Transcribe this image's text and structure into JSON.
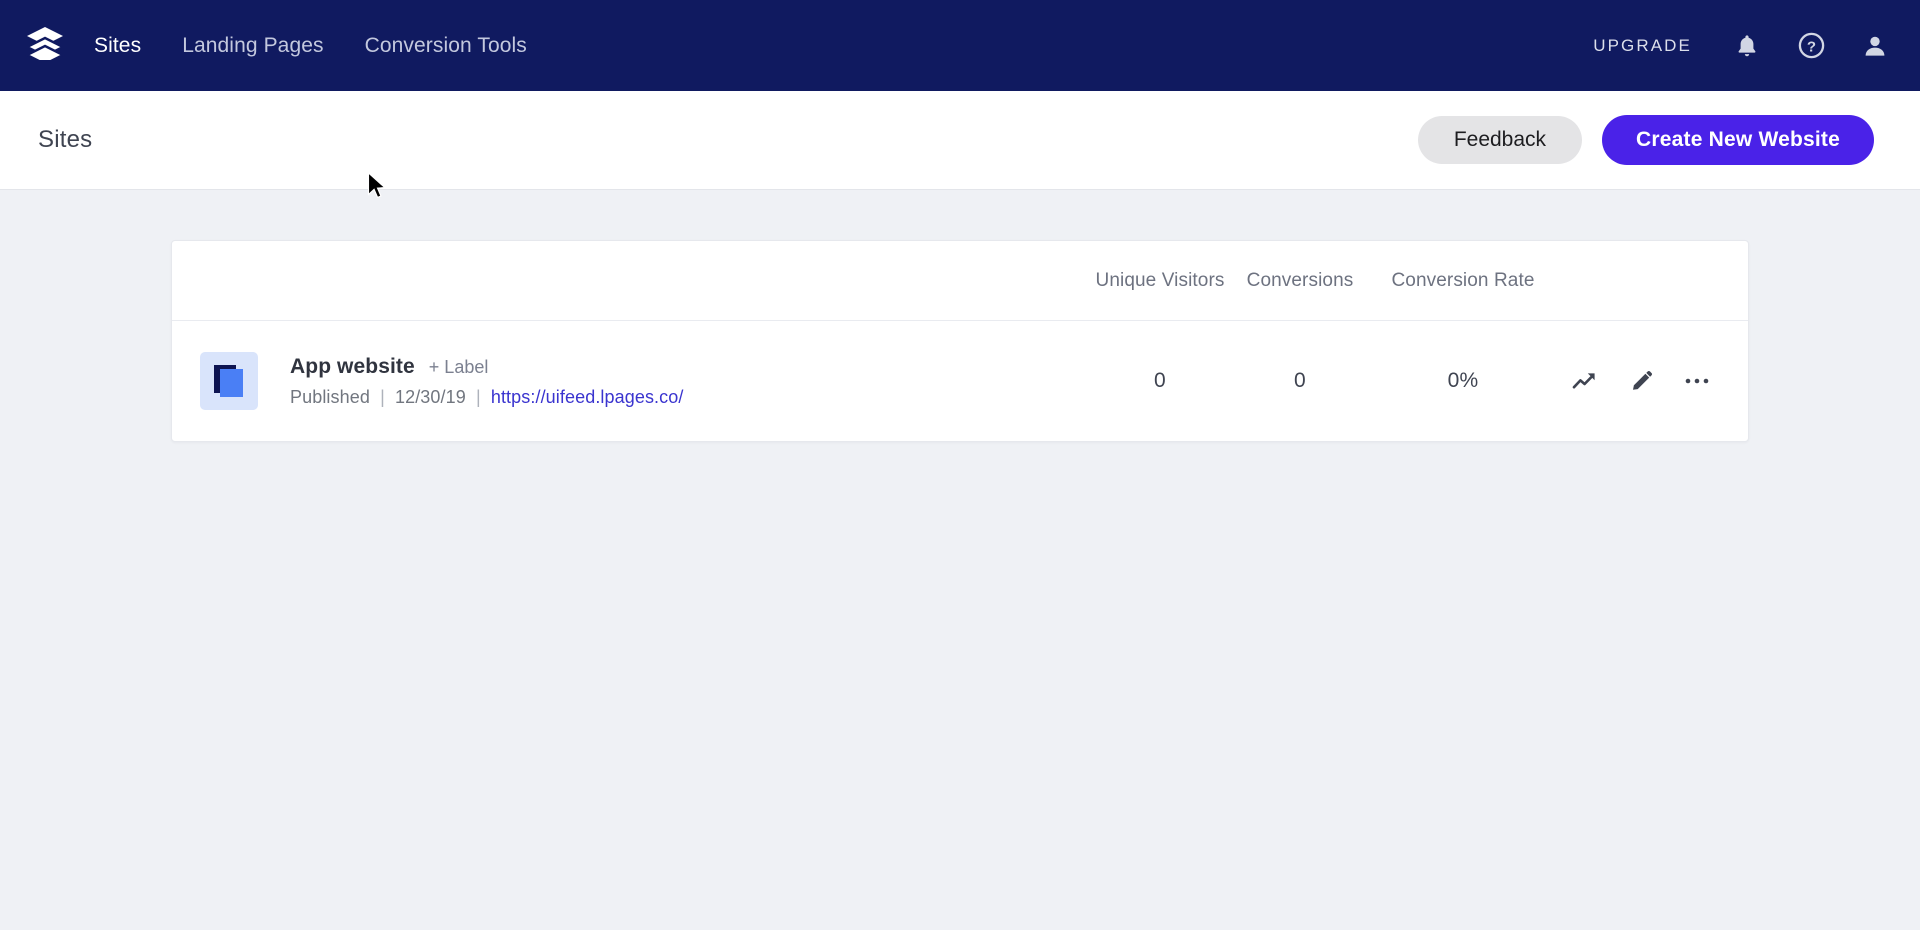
{
  "nav": {
    "logo_icon": "stacked-layers-logo",
    "links": [
      {
        "label": "Sites",
        "active": true
      },
      {
        "label": "Landing Pages",
        "active": false
      },
      {
        "label": "Conversion Tools",
        "active": false
      }
    ],
    "upgrade_label": "UPGRADE",
    "icons": [
      {
        "name": "notifications-bell-icon"
      },
      {
        "name": "help-question-circle-icon"
      },
      {
        "name": "account-person-icon"
      }
    ],
    "background_color": "#101a60"
  },
  "subheader": {
    "title": "Sites",
    "feedback_label": "Feedback",
    "create_label": "Create New Website",
    "create_color": "#4a22e8",
    "feedback_color": "#e4e4e6"
  },
  "table": {
    "columns": [
      {
        "label": "Unique Visitors"
      },
      {
        "label": "Conversions"
      },
      {
        "label": "Conversion Rate"
      }
    ],
    "rows": [
      {
        "thumbnail_icon": "website-page-thumbnail",
        "name": "App website",
        "add_label": "+ Label",
        "status": "Published",
        "date": "12/30/19",
        "url": "https://uifeed.lpages.co/",
        "unique_visitors": "0",
        "conversions": "0",
        "conversion_rate": "0%",
        "actions": [
          {
            "name": "analytics-trending-up-icon"
          },
          {
            "name": "edit-pencil-icon"
          },
          {
            "name": "more-options-ellipsis-icon"
          }
        ]
      }
    ]
  },
  "page": {
    "background_color": "#eff1f5",
    "link_color": "#3a34cf"
  }
}
